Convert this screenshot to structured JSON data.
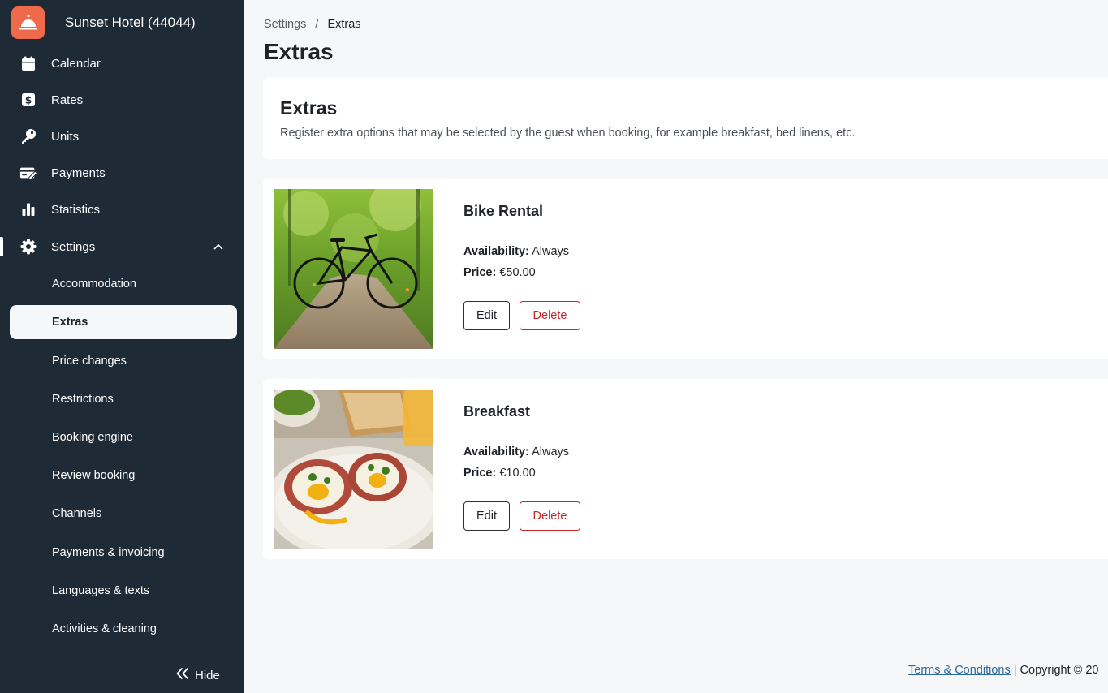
{
  "sidebar": {
    "hotel_name": "Sunset Hotel (44044)",
    "nav": [
      {
        "label": "Calendar",
        "icon": "calendar-icon"
      },
      {
        "label": "Rates",
        "icon": "dollar-icon"
      },
      {
        "label": "Units",
        "icon": "key-icon"
      },
      {
        "label": "Payments",
        "icon": "payment-icon"
      },
      {
        "label": "Statistics",
        "icon": "bar-chart-icon"
      },
      {
        "label": "Settings",
        "icon": "gear-icon"
      }
    ],
    "settings_sub": [
      "Accommodation",
      "Extras",
      "Price changes",
      "Restrictions",
      "Booking engine",
      "Review booking",
      "Channels",
      "Payments & invoicing",
      "Languages & texts",
      "Activities & cleaning"
    ],
    "selected_sub": "Extras",
    "hide_label": "Hide"
  },
  "breadcrumb": {
    "parent": "Settings",
    "separator": "/",
    "current": "Extras"
  },
  "page_title": "Extras",
  "intro": {
    "title": "Extras",
    "description": "Register extra options that may be selected by the guest when booking, for example breakfast, bed linens, etc."
  },
  "extras": [
    {
      "name": "Bike Rental",
      "availability_label": "Availability:",
      "availability": "Always",
      "price_label": "Price:",
      "price": "€50.00",
      "edit_label": "Edit",
      "delete_label": "Delete",
      "image": "bicycle-photo"
    },
    {
      "name": "Breakfast",
      "availability_label": "Availability:",
      "availability": "Always",
      "price_label": "Price:",
      "price": "€10.00",
      "edit_label": "Edit",
      "delete_label": "Delete",
      "image": "breakfast-photo"
    }
  ],
  "footer": {
    "terms_link": "Terms & Conditions",
    "copyright": " | Copyright © 20"
  },
  "colors": {
    "sidebar_bg": "#1f2a37",
    "brand": "#ef6a4a",
    "delete": "#c62828",
    "link": "#2b6aa0"
  }
}
